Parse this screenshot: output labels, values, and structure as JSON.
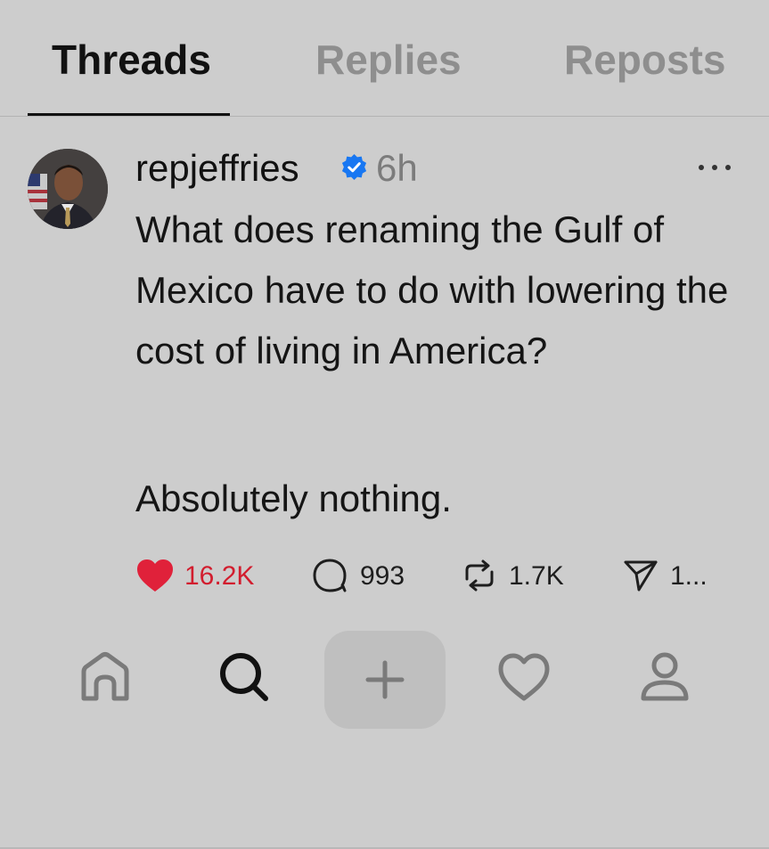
{
  "tabs": [
    {
      "label": "Threads"
    },
    {
      "label": "Replies"
    },
    {
      "label": "Reposts"
    }
  ],
  "post": {
    "username": "repjeffries",
    "time": "6h",
    "text_line1": "What does renaming the Gulf of Mexico have to do with lowering the cost of living in America?",
    "text_line2": "Absolutely nothing."
  },
  "actions": {
    "likes": "16.2K",
    "replies": "993",
    "reposts": "1.7K",
    "shares": "1..."
  },
  "colors": {
    "background": "#cdcdcd",
    "like_red": "#d21d2e",
    "verified_blue": "#1877f2"
  },
  "icons": [
    "verified-badge-icon",
    "more-icon",
    "heart-icon",
    "comment-icon",
    "repost-icon",
    "share-icon",
    "home-icon",
    "search-icon",
    "plus-icon",
    "activity-heart-icon",
    "profile-icon"
  ]
}
